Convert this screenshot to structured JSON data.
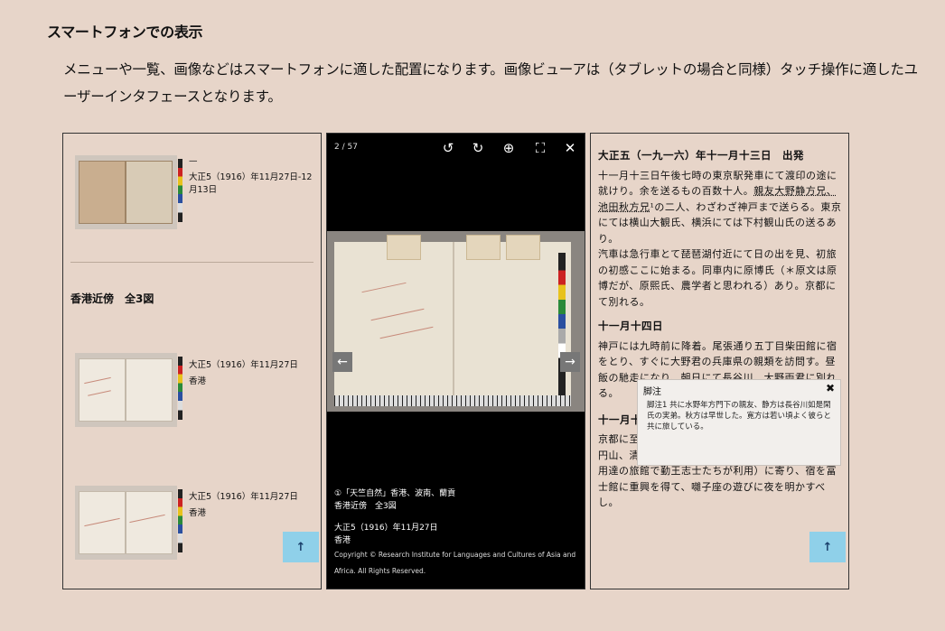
{
  "heading": "スマートフォンでの表示",
  "description": "メニューや一覧、画像などはスマートフォンに適した配置になります。画像ビューアは（タブレットの場合と同様）タッチ操作に適したユーザーインタフェースとなります。",
  "left_panel": {
    "top_item": {
      "title": "—",
      "date": "大正5（1916）年11月27日-12月13日"
    },
    "section_title": "香港近傍　全3図",
    "items": [
      {
        "date": "大正5（1916）年11月27日",
        "place": "香港"
      },
      {
        "date": "大正5（1916）年11月27日",
        "place": "香港"
      }
    ],
    "up_label": "↑"
  },
  "viewer": {
    "counter": "2 / 57",
    "tools": {
      "rotate_left": "↺",
      "rotate_right": "↻",
      "zoom": "⊕",
      "fullscreen": "⛶",
      "close": "✕"
    },
    "prev": "←",
    "next": "→",
    "caption_title": "①「天竺自然」香港、波南、蘭貢",
    "caption_group": "香港近傍　全3図",
    "caption_date": "大正5（1916）年11月27日",
    "caption_place": "香港",
    "copyright": "Copyright © Research Institute for Languages and Cultures of Asia and Africa. All Rights Reserved."
  },
  "text_panel": {
    "entry1_head": "大正五（一九一六）年十一月十三日　出発",
    "entry1_body_a": "十一月十三日午後七時の東京駅発車にて渡印の途に就けり。余を送るもの百数十人。",
    "entry1_body_link": "親友大野静方兄、池田秋方兄",
    "entry1_body_b": "¹の二人、わざわざ神戸まで送らる。東京にては横山大観氏、横浜にては下村観山氏の送るあり。",
    "entry1_body_c": "汽車は急行車とて琵琶湖付近にて日の出を見、初旅の初感ここに始まる。同車内に原博氏（＊原文は原博だが、原熙氏、農学者と思われる）あり。京都にて別れる。",
    "entry2_head": "十一月十四日",
    "entry2_body": "神戸には九時前に降着。尾張通り五丁目柴田館に宿をとり、すぐに大野君の兵庫県の親類を訪問す。昼飯の馳走になり、朝日にて長谷川、大野両君に別れる。",
    "entry3_head": "十一月十五日",
    "entry3_body": "京都に至りて近宗氏を岡崎の図書館に訪ね、四条、円山、清水を廻り、綱手の小川亭方（＊幕末後藩御用達の旅館で勤王志士たちが利用）に寄り、宿を冨士館に重興を得て、囃子座の遊びに夜を明かすべし。",
    "footnote_title": "脚注",
    "footnote_close": "✖",
    "footnote_body": "脚注1 共に水野年方門下の親友、静方は長谷川如是閑氏の実弟。秋方は早世した。寛方は若い頃よく彼らと共に旅している。",
    "up_label": "↑"
  }
}
